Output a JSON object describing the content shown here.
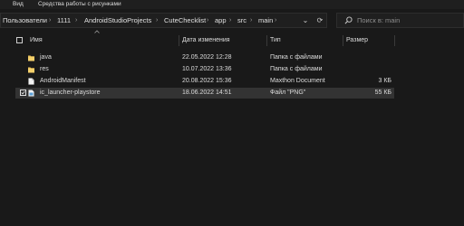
{
  "ribbon": {
    "tabs": [
      "Вид",
      "Средства работы с рисунками"
    ]
  },
  "address_bar": {
    "crumbs": [
      "Пользователи",
      "1111",
      "AndroidStudioProjects",
      "CuteChecklist",
      "app",
      "src",
      "main"
    ],
    "dropdown_glyph": "⌄",
    "refresh_glyph": "⟳"
  },
  "search": {
    "placeholder": "Поиск в: main"
  },
  "columns": {
    "name": "Имя",
    "date": "Дата изменения",
    "type": "Тип",
    "size": "Размер"
  },
  "files": [
    {
      "name": "java",
      "date": "22.05.2022 12:28",
      "type": "Папка с файлами",
      "size": "",
      "icon": "folder-icon",
      "selected": false,
      "checked": false
    },
    {
      "name": "res",
      "date": "10.07.2022 13:36",
      "type": "Папка с файлами",
      "size": "",
      "icon": "folder-icon",
      "selected": false,
      "checked": false
    },
    {
      "name": "AndroidManifest",
      "date": "20.08.2022 15:36",
      "type": "Maxthon Document",
      "size": "3 КБ",
      "icon": "document-icon",
      "selected": false,
      "checked": false
    },
    {
      "name": "ic_launcher-playstore",
      "date": "18.06.2022 14:51",
      "type": "Файл \"PNG\"",
      "size": "55 КБ",
      "icon": "image-file-icon",
      "selected": true,
      "checked": true
    }
  ],
  "colors": {
    "background": "#191919",
    "folder": "#e8c15a",
    "selection": "#333333"
  }
}
